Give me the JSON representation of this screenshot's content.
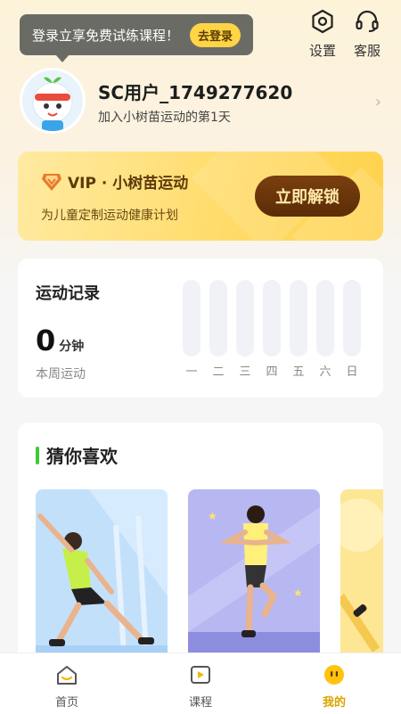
{
  "login_tip": {
    "text": "登录立享免费试练课程！",
    "button": "去登录"
  },
  "top_actions": {
    "settings": "设置",
    "service": "客服"
  },
  "profile": {
    "username": "SC用户_1749277620",
    "subtitle": "加入小树苗运动的第1天"
  },
  "vip": {
    "title": "VIP · 小树苗运动",
    "desc": "为儿童定制运动健康计划",
    "button": "立即解锁"
  },
  "record": {
    "title": "运动记录",
    "minutes": "0",
    "unit": "分钟",
    "subtitle": "本周运动",
    "days": [
      "一",
      "二",
      "三",
      "四",
      "五",
      "六",
      "日"
    ]
  },
  "guess": {
    "title": "猜你喜欢"
  },
  "tabs": {
    "home": "首页",
    "course": "课程",
    "mine": "我的"
  },
  "colors": {
    "accent": "#ffd545",
    "vip_btn": "#5b2c06",
    "green": "#3ec93a",
    "active_tab": "#d8a400"
  }
}
